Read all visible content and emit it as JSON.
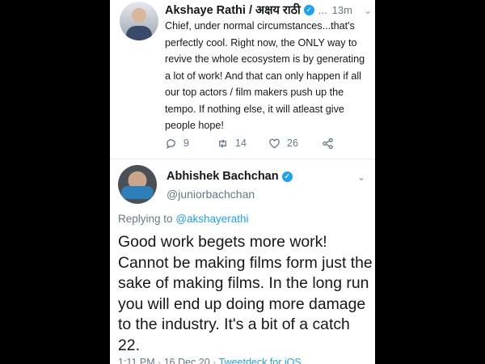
{
  "first_tweet": {
    "author_name": "Akshaye Rathi / अक्षय राठी",
    "ellipsis": "...",
    "time": "13m",
    "text": "Chief, under normal circumstances...that's perfectly cool. Right now, the ONLY way to revive the whole ecosystem is by generating a lot of work! And that can only happen if all our top actors / film makers push up the tempo. If nothing else, it will atleast give people hope!",
    "reply_count": "9",
    "retweet_count": "14",
    "like_count": "26",
    "icons": [
      "reply-icon",
      "retweet-icon",
      "like-icon",
      "share-icon",
      "verified-icon",
      "chevron-down-icon"
    ]
  },
  "second_tweet": {
    "author_name": "Abhishek Bachchan",
    "handle": "@juniorbachchan",
    "replying_prefix": "Replying to",
    "replying_handle": "@akshayerathi",
    "text": "Good work begets more work! Cannot be making films form just the sake of making films. In the long run you will end up doing more damage to the industry. It's a bit of a catch 22.",
    "timestamp": "1:11 PM · 16 Dec 20",
    "client": "Tweetdeck for iOS"
  },
  "colors": {
    "accent": "#1da1f2",
    "text": "#14171a",
    "muted": "#657786"
  }
}
